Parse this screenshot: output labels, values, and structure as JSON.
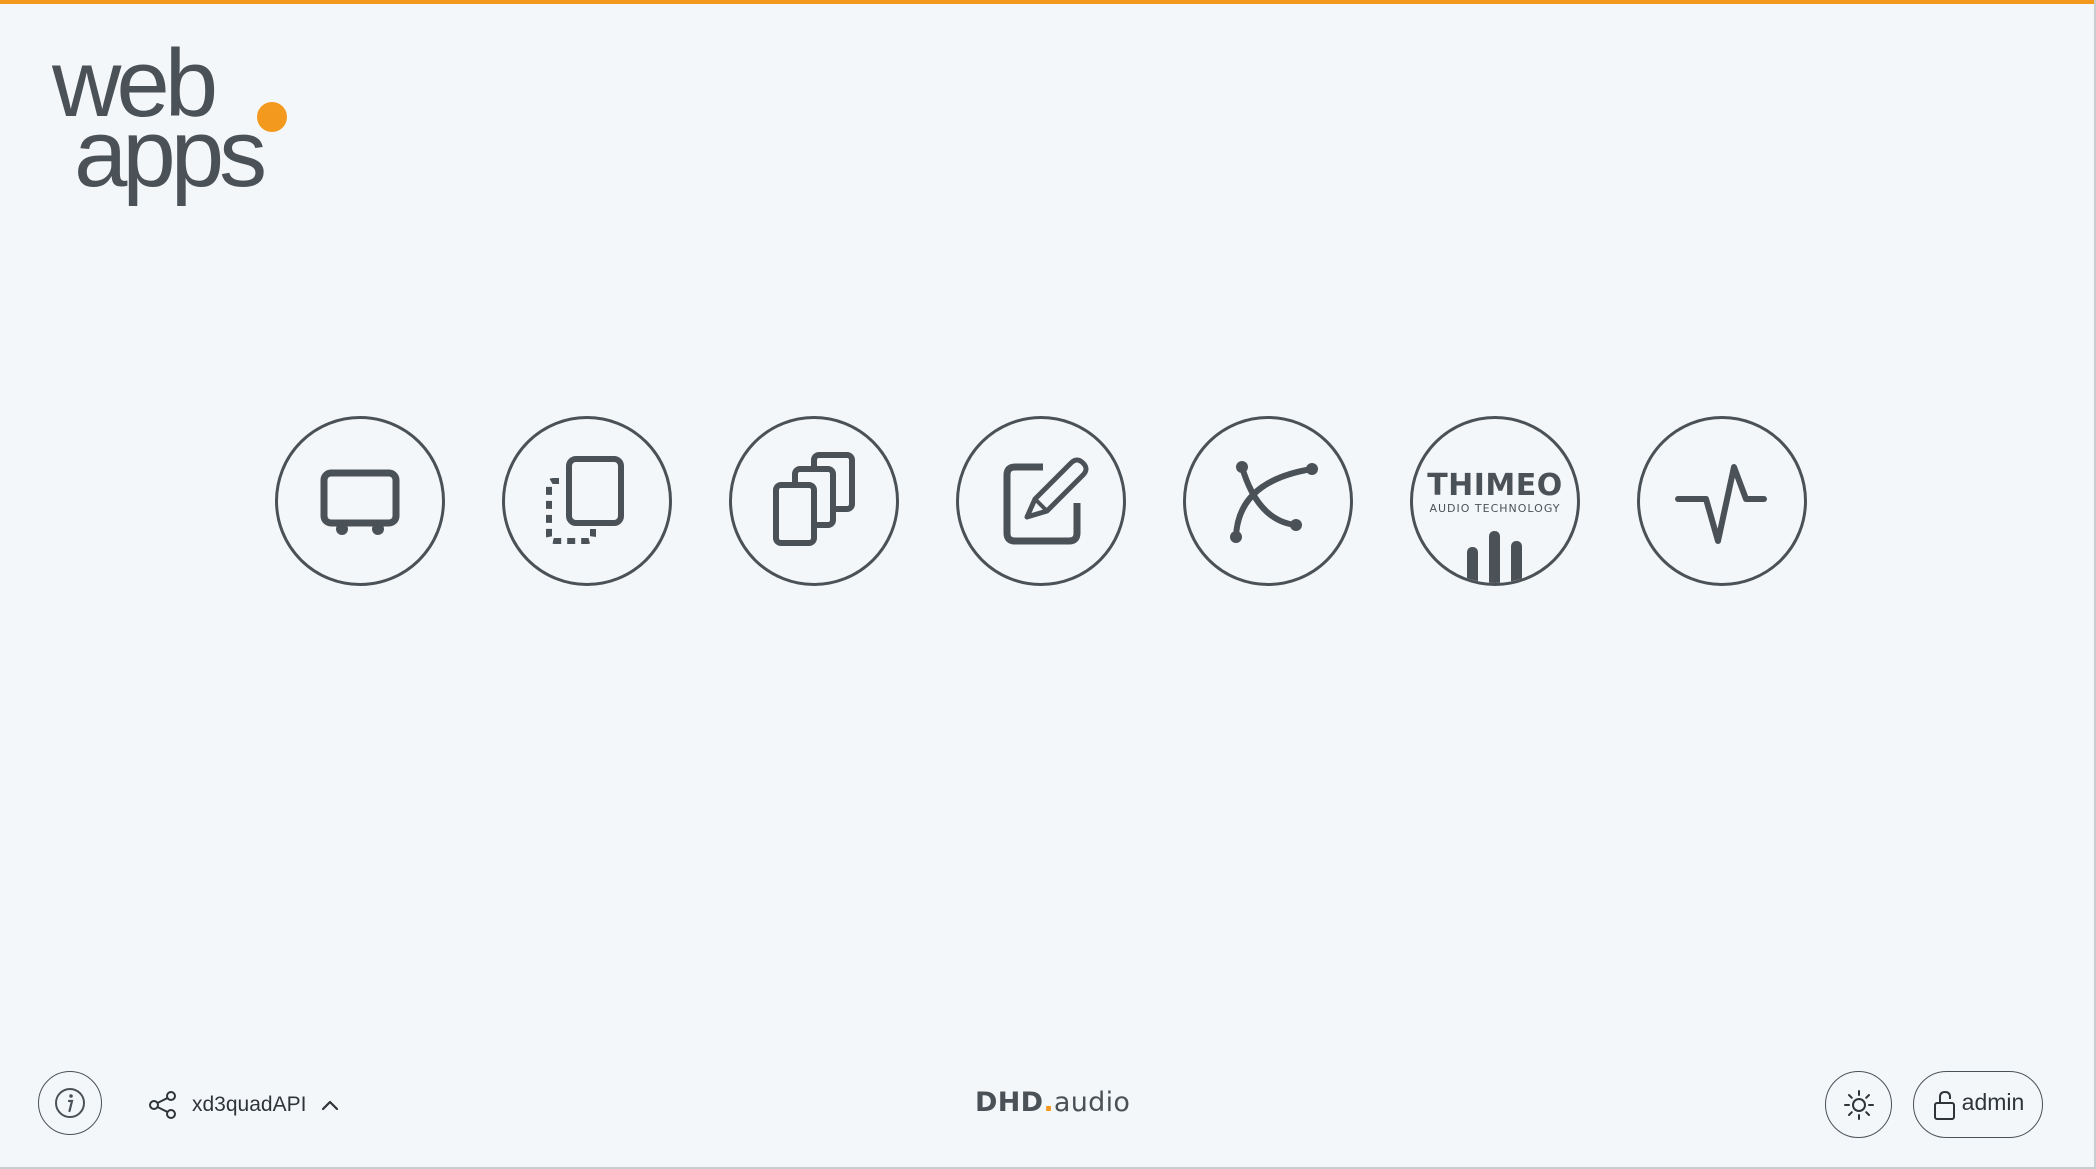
{
  "colors": {
    "accent": "#f39a1e",
    "foreground": "#4b5257",
    "background": "#f4f7fa"
  },
  "logo": {
    "line1": "web",
    "line2": "apps"
  },
  "apps": [
    {
      "icon": "monitor-icon"
    },
    {
      "icon": "copy-panel-icon"
    },
    {
      "icon": "stacked-pages-icon"
    },
    {
      "icon": "edit-icon"
    },
    {
      "icon": "curve-icon"
    },
    {
      "icon": "thimeo-logo",
      "brand": "THIMEO",
      "tagline": "AUDIO TECHNOLOGY"
    },
    {
      "icon": "pulse-icon"
    }
  ],
  "footer": {
    "info_icon": "info-icon",
    "connection_icon": "share-icon",
    "connection_name": "xd3quadAPI",
    "connection_chevron": "chevron-up-icon",
    "brand_main": "DHD",
    "brand_dot": ".",
    "brand_suffix": "audio",
    "theme_icon": "sun-icon",
    "user_icon": "unlock-icon",
    "user_name": "admin"
  }
}
